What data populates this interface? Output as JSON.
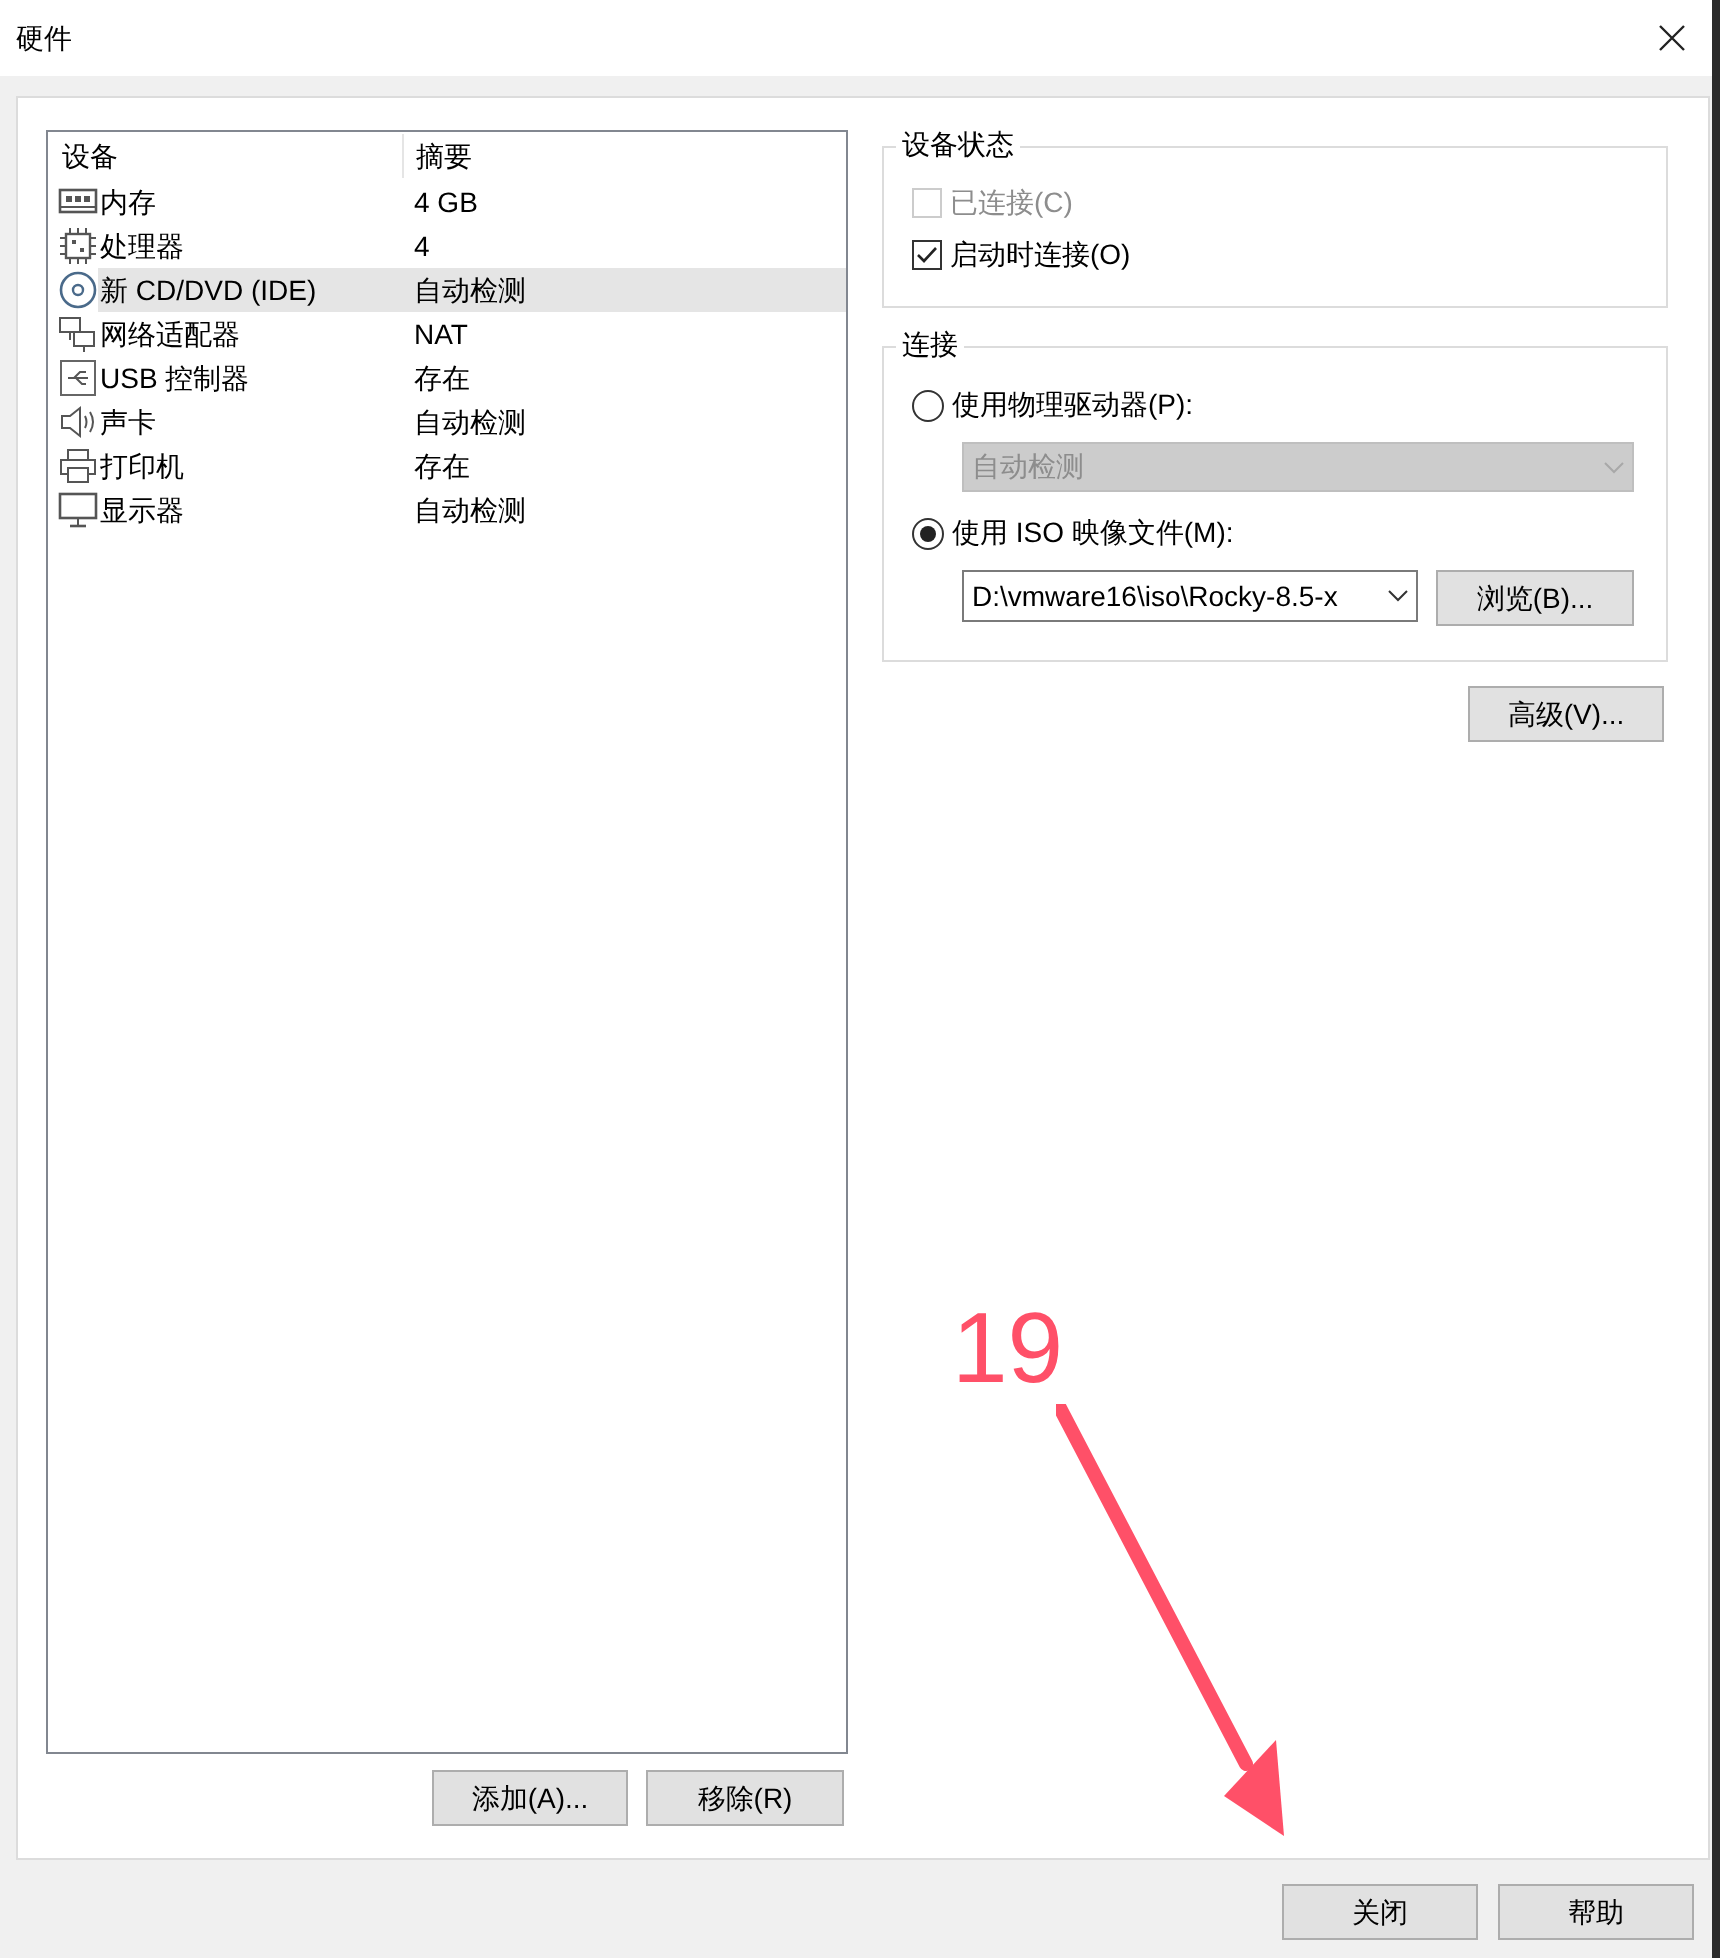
{
  "window": {
    "title": "硬件"
  },
  "device_list": {
    "columns": [
      "设备",
      "摘要"
    ],
    "rows": [
      {
        "kind": "memory",
        "device": "内存",
        "summary": "4 GB",
        "selected": false
      },
      {
        "kind": "cpu",
        "device": "处理器",
        "summary": "4",
        "selected": false
      },
      {
        "kind": "cdrom",
        "device": "新 CD/DVD (IDE)",
        "summary": "自动检测",
        "selected": true
      },
      {
        "kind": "network",
        "device": "网络适配器",
        "summary": "NAT",
        "selected": false
      },
      {
        "kind": "usb",
        "device": "USB 控制器",
        "summary": "存在",
        "selected": false
      },
      {
        "kind": "sound",
        "device": "声卡",
        "summary": "自动检测",
        "selected": false
      },
      {
        "kind": "printer",
        "device": "打印机",
        "summary": "存在",
        "selected": false
      },
      {
        "kind": "display",
        "device": "显示器",
        "summary": "自动检测",
        "selected": false
      }
    ]
  },
  "list_buttons": [
    "添加(A)...",
    "移除(R)"
  ],
  "device_status": {
    "title": "设备状态",
    "checkboxes": [
      {
        "label": "已连接(C)",
        "checked": false,
        "disabled": true
      },
      {
        "label": "启动时连接(O)",
        "checked": true,
        "disabled": false
      }
    ]
  },
  "connection": {
    "title": "连接",
    "physical": {
      "label": "使用物理驱动器(P):",
      "selected": false,
      "dropdown": {
        "value": "自动检测",
        "disabled": true
      }
    },
    "iso": {
      "label": "使用 ISO 映像文件(M):",
      "selected": true,
      "combo": {
        "value": "D:\\vmware16\\iso\\Rocky-8.5-x",
        "disabled": false
      },
      "browse_button": "浏览(B)..."
    }
  },
  "advanced_button": "高级(V)...",
  "footer_buttons": [
    "关闭",
    "帮助"
  ],
  "annotation": {
    "label": "19"
  }
}
